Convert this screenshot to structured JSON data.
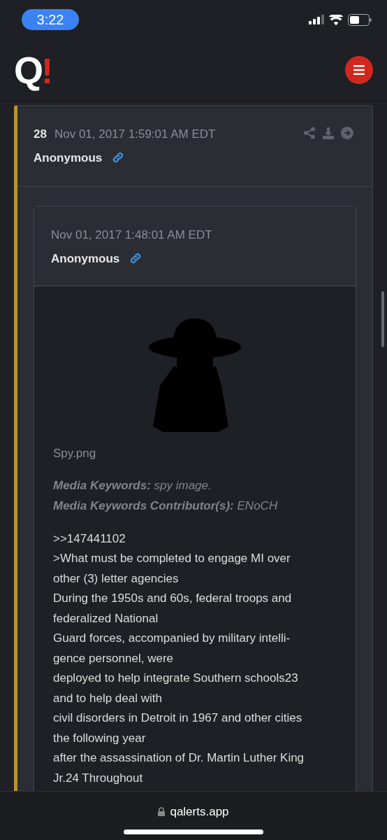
{
  "status_bar": {
    "time": "3:22"
  },
  "header": {
    "logo_letter": "Q",
    "logo_mark": "!"
  },
  "post": {
    "number": "28",
    "date": "Nov 01, 2017 1:59:01 AM EDT",
    "author": "Anonymous",
    "quote": {
      "date": "Nov 01, 2017 1:48:01 AM EDT",
      "author": "Anonymous",
      "media": {
        "kind": "picture",
        "filename": "Spy.png"
      },
      "keywords": [
        {
          "label": "Media Keywords:",
          "value": "spy image."
        },
        {
          "label": "Media Keywords Contributor(s):",
          "value": "ENoCH"
        }
      ],
      "lines": [
        ">>147441102",
        ">What must be completed to engage MI over",
        "other (3) letter agencies",
        "During the 1950s and 60s, federal troops and",
        "federalized National",
        "Guard forces, accompanied by military intelli-",
        "gence personnel, were",
        "deployed to help integrate Southern schools23",
        "and to help deal with",
        "civil disorders in Detroit in 1967 and other cities",
        "the following year",
        "after the assassination of Dr. Martin Luther King",
        "Jr.24 Throughout"
      ]
    }
  },
  "address_bar": {
    "url": "qalerts.app"
  }
}
